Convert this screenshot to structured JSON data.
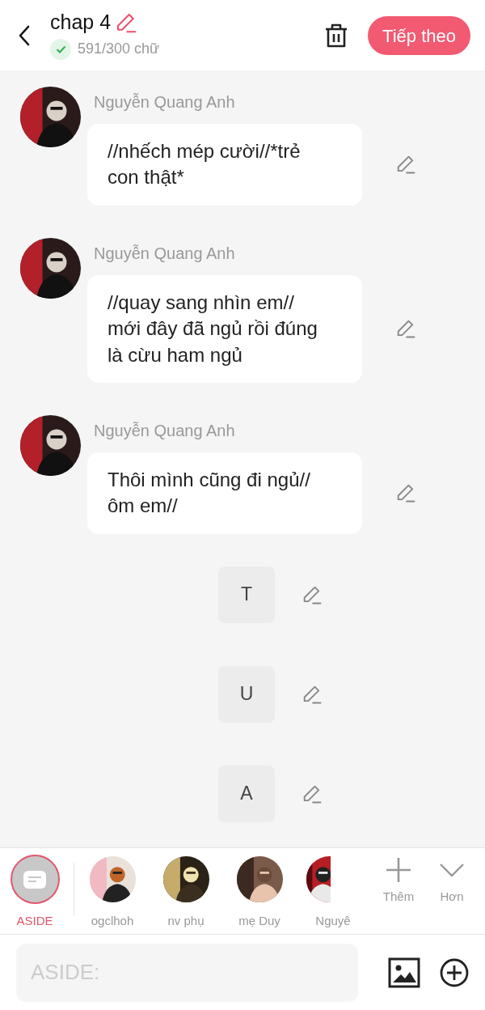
{
  "header": {
    "title": "chap 4",
    "word_count": "591/300 chữ",
    "count_ok": true,
    "next_button": "Tiếp theo"
  },
  "messages": [
    {
      "kind": "character",
      "speaker": "Nguyễn Quang Anh",
      "text": "//nhếch mép cười//*trẻ con thật*"
    },
    {
      "kind": "character",
      "speaker": "Nguyễn Quang Anh",
      "text": "//quay sang nhìn em// mới đây đã ngủ rồi đúng là cừu ham ngủ"
    },
    {
      "kind": "character",
      "speaker": "Nguyễn Quang Anh",
      "text": "Thôi mình cũng đi ngủ// ôm em//"
    },
    {
      "kind": "aside",
      "text": "T"
    },
    {
      "kind": "aside",
      "text": "U"
    },
    {
      "kind": "aside",
      "text": "A"
    }
  ],
  "characters": [
    {
      "kind": "aside",
      "name": "ASIDE",
      "selected": true
    },
    {
      "kind": "picture",
      "name": "ogclhoh",
      "selected": false
    },
    {
      "kind": "picture",
      "name": "nv phụ",
      "selected": false
    },
    {
      "kind": "picture",
      "name": "mẹ Duy",
      "selected": false
    },
    {
      "kind": "picture",
      "name": "Nguyê",
      "selected": false
    }
  ],
  "character_actions": [
    "Thêm",
    "Hơn"
  ],
  "composer": {
    "placeholder": "ASIDE:"
  }
}
